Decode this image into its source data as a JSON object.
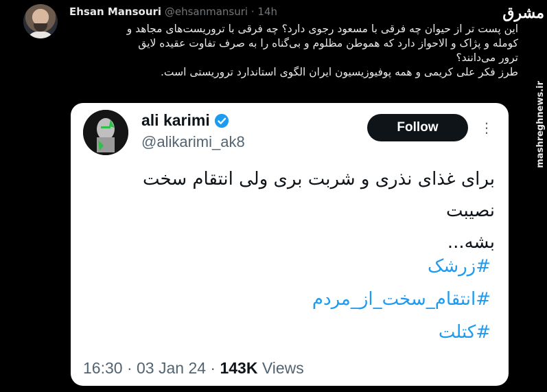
{
  "tweet": {
    "author_name": "Ehsan Mansouri",
    "author_handle": "@ehsanmansuri",
    "separator": "·",
    "time": "14h",
    "lines": [
      "این پست تر از حیوان چه فرقی با مسعود رجوی دارد؟ چه فرقی با تروریست‌های مجاهد و",
      "کومله و پژاک و الاحواز دارد که هموطن مظلوم و بی‌گناه را به صرف تفاوت عقیده لایق",
      "ترور می‌دانند؟",
      "طرز فکر علی کریمی و همه پوفیوزیسیون ایران الگوی استاندارد تروریستی است."
    ]
  },
  "quoted": {
    "name": "ali karimi",
    "handle": "@alikarimi_ak8",
    "follow_label": "Follow",
    "more_label": "⋮",
    "text_lines": [
      "برای غذای نذری و شربت بری ولی انتقام سخت نصیبت",
      "بشه..."
    ],
    "hashtags": [
      "#زرشک",
      "#انتقام_سخت_از_مردم",
      "#کتلت"
    ],
    "timestamp": "16:30 · 03 Jan 24 ·",
    "views_count": "143K",
    "views_label": "Views"
  },
  "watermark": {
    "logo": "مشرق",
    "site": "mashreghnews.ir"
  },
  "colors": {
    "background": "#000000",
    "card": "#ffffff",
    "hashtag": "#1d9bf0",
    "verified": "#1d9bf0",
    "follow_bg": "#0f1419"
  },
  "icons": {
    "verified": "verified-badge-icon",
    "more": "more-options-icon"
  }
}
